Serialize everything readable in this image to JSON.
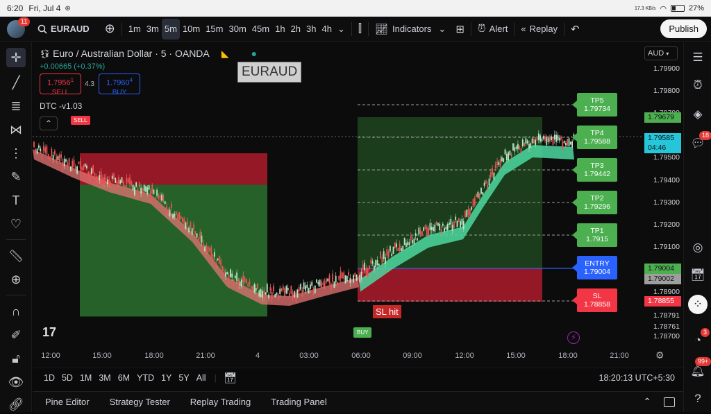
{
  "status_bar": {
    "time": "6:20",
    "date": "Fri, Jul 4",
    "net_speed": "17.3 KB/s",
    "battery": "27%"
  },
  "topbar": {
    "avatar_badge": "11",
    "symbol": "EURAUD",
    "intervals": [
      "1m",
      "3m",
      "5m",
      "10m",
      "15m",
      "30m",
      "45m",
      "1h",
      "2h",
      "3h",
      "4h"
    ],
    "active_interval": "5m",
    "indicators_label": "Indicators",
    "alert_label": "Alert",
    "replay_label": "Replay",
    "publish_label": "Publish"
  },
  "legend": {
    "title": "Euro / Australian Dollar · 5 · OANDA",
    "change": "+0.00665 (+0.37%)",
    "sell_price": "1.7956",
    "sell_price_sup": "1",
    "sell_label": "SELL",
    "spread": "4.3",
    "buy_price": "1.7960",
    "buy_price_sup": "4",
    "buy_label": "BUY",
    "indicator_name": "DTC -v1.03",
    "symbol_watermark": "EURAUD"
  },
  "currency": "AUD",
  "price_levels": [
    "1.79900",
    "1.79800",
    "1.79700",
    "1.79500",
    "1.79400",
    "1.79300",
    "1.79200",
    "1.79100",
    "1.78900",
    "1.78791",
    "1.78761",
    "1.78700"
  ],
  "price_tags": [
    {
      "value": "1.79679",
      "color": "#4caf50"
    },
    {
      "value": "1.79585",
      "color": "#26c6da"
    },
    {
      "value": "04:46",
      "color": "#26c6da"
    },
    {
      "value": "1.79004",
      "color": "#4caf50"
    },
    {
      "value": "1.79002",
      "color": "#9e9e9e"
    },
    {
      "value": "1.78855",
      "color": "#f23645"
    }
  ],
  "targets": [
    {
      "label": "TP5",
      "price": "1.79734",
      "kind": "green"
    },
    {
      "label": "TP4",
      "price": "1.79588",
      "kind": "green"
    },
    {
      "label": "TP3",
      "price": "1.79442",
      "kind": "green"
    },
    {
      "label": "TP2",
      "price": "1.79296",
      "kind": "green"
    },
    {
      "label": "TP1",
      "price": "1.7915",
      "kind": "green"
    },
    {
      "label": "ENTRY",
      "price": "1.79004",
      "kind": "blue"
    },
    {
      "label": "SL",
      "price": "1.78858",
      "kind": "red"
    }
  ],
  "signals": {
    "sell": "SELL",
    "buy": "BUY",
    "sl_hit": "SL hit"
  },
  "time_labels": [
    "12:00",
    "15:00",
    "18:00",
    "21:00",
    "4",
    "03:00",
    "06:00",
    "09:00",
    "12:00",
    "15:00",
    "18:00",
    "21:00"
  ],
  "ranges": [
    "1D",
    "5D",
    "1M",
    "3M",
    "6M",
    "YTD",
    "1Y",
    "5Y",
    "All"
  ],
  "clock": "18:20:13 UTC+5:30",
  "bottom_tabs": [
    "Pine Editor",
    "Strategy Tester",
    "Replay Trading",
    "Trading Panel"
  ],
  "right_badges": {
    "chat": "18",
    "feed": "3",
    "notifications": "99+"
  }
}
